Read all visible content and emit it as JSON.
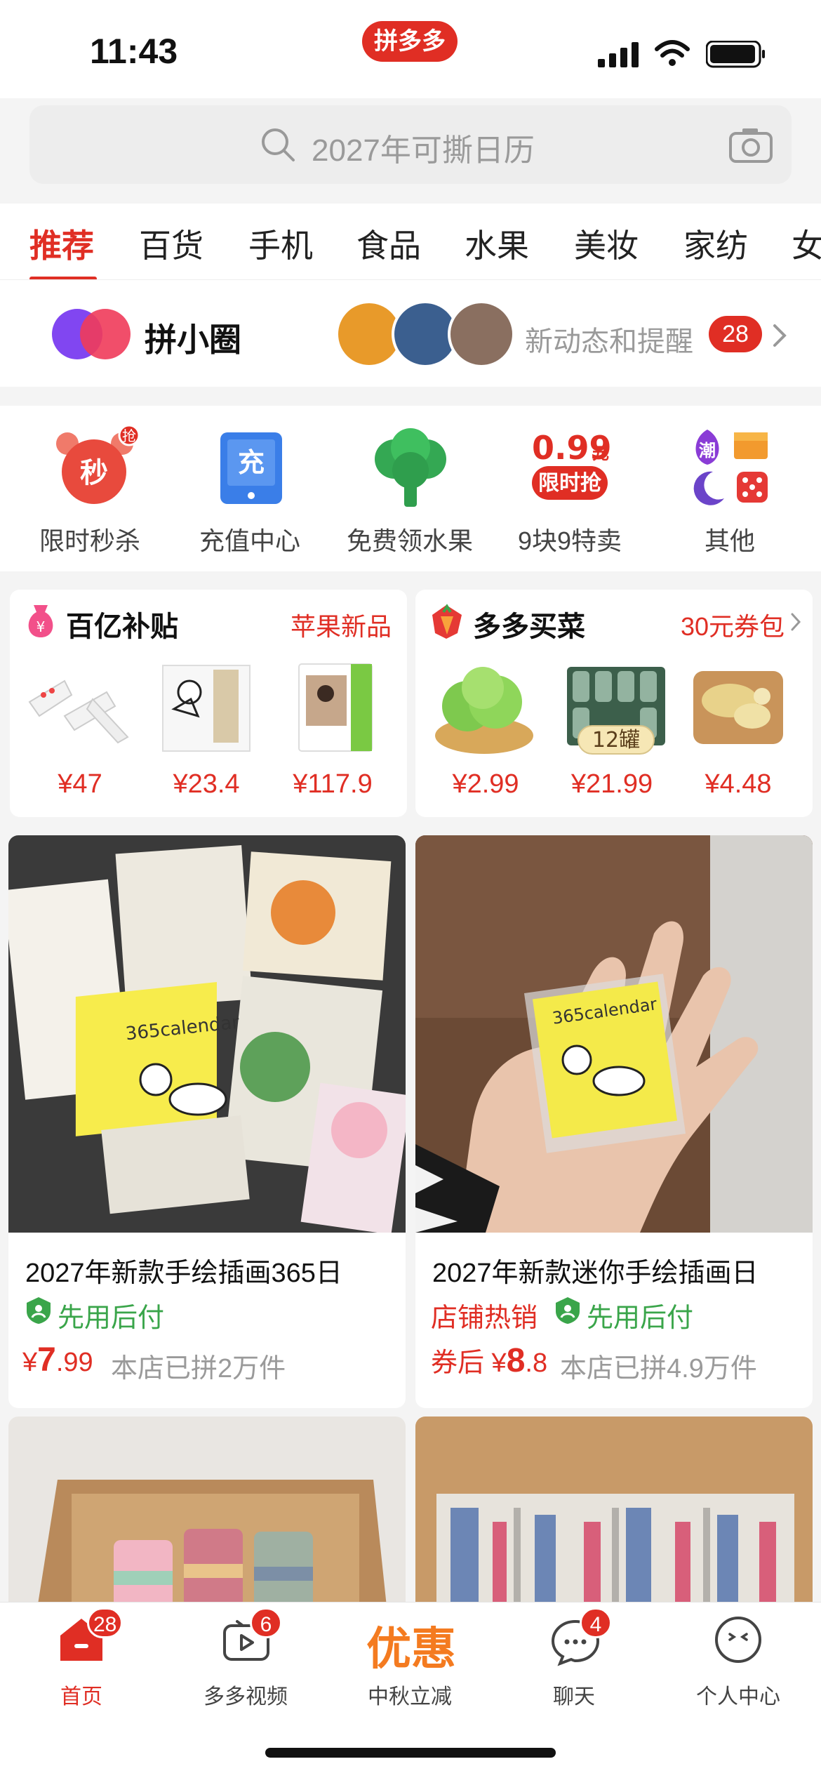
{
  "status_bar": {
    "time": "11:43",
    "brand_badge": "拼多多"
  },
  "search": {
    "placeholder": "2027年可撕日历"
  },
  "tabs": [
    {
      "label": "推荐",
      "active": true
    },
    {
      "label": "百货"
    },
    {
      "label": "手机"
    },
    {
      "label": "食品"
    },
    {
      "label": "水果"
    },
    {
      "label": "美妆"
    },
    {
      "label": "家纺"
    },
    {
      "label": "女"
    }
  ],
  "circle": {
    "title": "拼小圈",
    "text": "新动态和提醒",
    "count": "28"
  },
  "quick_nav": [
    {
      "label": "限时秒杀",
      "icon": "alarm-clock-icon",
      "icon_text": "秒",
      "badge": "抢"
    },
    {
      "label": "充值中心",
      "icon": "recharge-icon",
      "icon_text": "充"
    },
    {
      "label": "免费领水果",
      "icon": "tree-icon"
    },
    {
      "label": "9块9特卖",
      "icon": "price-tag-icon",
      "price": "0.99",
      "unit": "元",
      "tag": "限时抢"
    },
    {
      "label": "其他",
      "icon": "grid-icons",
      "icon_text": "潮"
    }
  ],
  "promos": [
    {
      "title": "百亿补贴",
      "link": "苹果新品",
      "prices": [
        "¥47",
        "¥23.4",
        "¥117.9"
      ]
    },
    {
      "title": "多多买菜",
      "link": "30元券包",
      "prices": [
        "¥2.99",
        "¥21.99",
        "¥4.48"
      ],
      "overlay": "12罐"
    }
  ],
  "products": [
    {
      "title": "2027年新款手绘插画365日",
      "tags": [
        "先用后付"
      ],
      "price_prefix": "¥",
      "price_big": "7",
      "price_small": ".99",
      "sold": "本店已拼2万件",
      "image_text": "365calendar"
    },
    {
      "title": "2027年新款迷你手绘插画日",
      "tags": [
        "店铺热销",
        "先用后付"
      ],
      "price_prefix": "券后 ¥",
      "price_big": "8",
      "price_small": ".8",
      "sold": "本店已拼4.9万件",
      "image_text": "365calendar"
    }
  ],
  "bottom_nav": [
    {
      "label": "首页",
      "icon": "home-icon",
      "badge": "28",
      "active": true
    },
    {
      "label": "多多视频",
      "icon": "video-icon",
      "badge": "6"
    },
    {
      "label": "中秋立减",
      "icon_text": "优惠"
    },
    {
      "label": "聊天",
      "icon": "chat-icon",
      "badge": "4"
    },
    {
      "label": "个人中心",
      "icon": "profile-icon"
    }
  ],
  "colors": {
    "accent": "#e02e24",
    "green": "#3aa54a",
    "orange": "#f47b20"
  }
}
